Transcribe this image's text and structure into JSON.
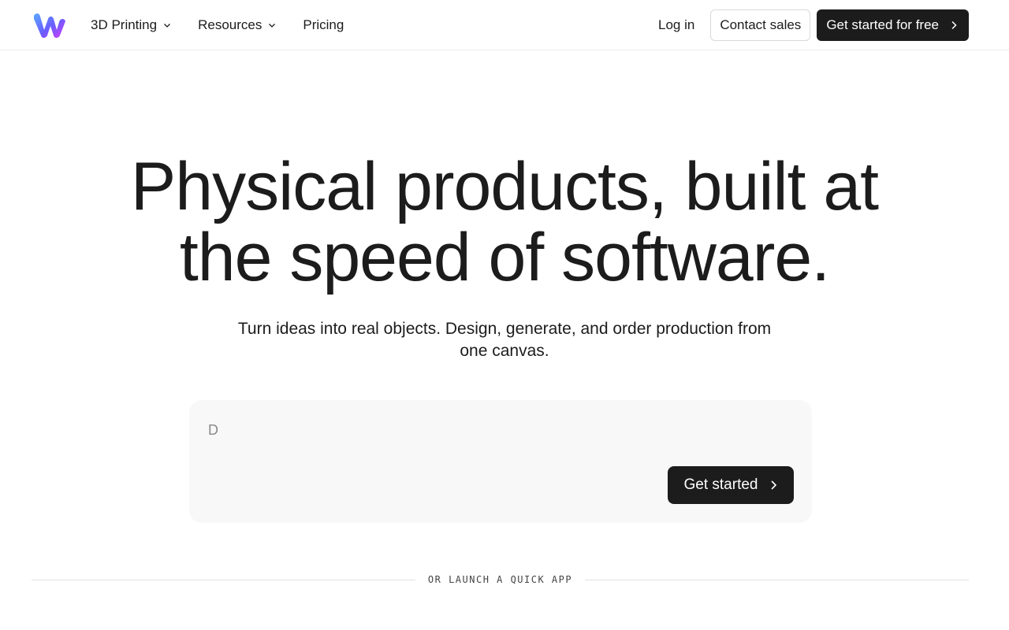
{
  "header": {
    "nav": [
      {
        "label": "3D Printing",
        "has_dropdown": true
      },
      {
        "label": "Resources",
        "has_dropdown": true
      },
      {
        "label": "Pricing",
        "has_dropdown": false
      }
    ],
    "login_label": "Log in",
    "contact_label": "Contact sales",
    "cta_label": "Get started for free",
    "logo_icon": "w-logo-icon"
  },
  "hero": {
    "title_line1": "Physical products, built at",
    "title_line2": "the speed of software.",
    "subtitle": "Turn ideas into real objects. Design, generate, and order production from one canvas."
  },
  "prompt": {
    "placeholder": "D",
    "value": "",
    "submit_label": "Get started"
  },
  "divider": {
    "label": "OR LAUNCH A QUICK APP"
  },
  "colors": {
    "text": "#1c1c1c",
    "dark_button": "#1c1c1c",
    "prompt_bg": "#f8f8f8",
    "border": "#ececec"
  }
}
